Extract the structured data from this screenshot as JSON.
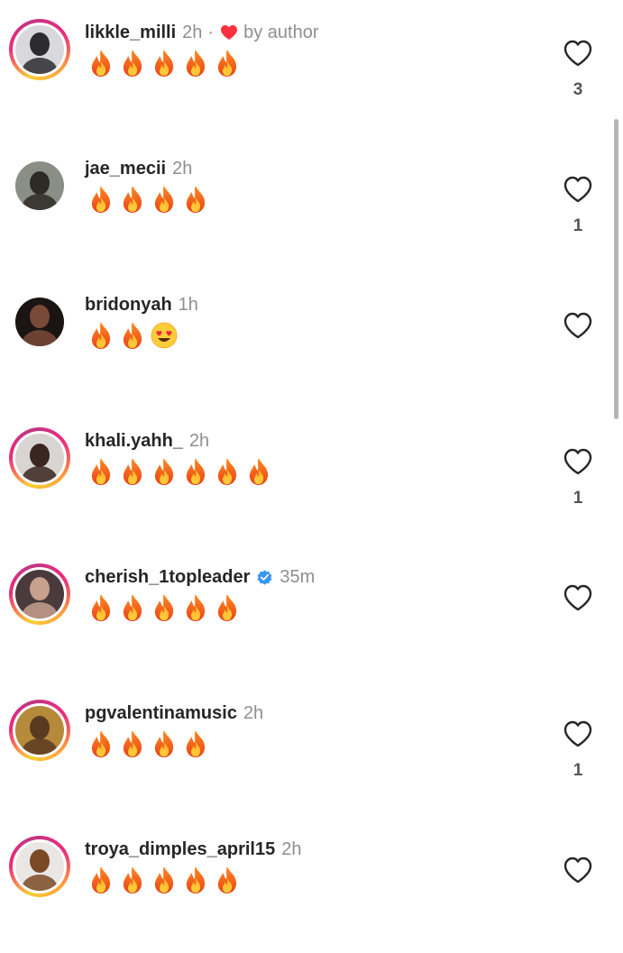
{
  "comments": [
    {
      "username": "likkle_milli",
      "time": "2h",
      "separator": "·",
      "liked_by_author": true,
      "by_author_label": "by author",
      "verified": false,
      "emojis": [
        "fire",
        "fire",
        "fire",
        "fire",
        "fire"
      ],
      "like_count": "3",
      "avatar_ring": true,
      "avatar_colors": [
        "#d9d9dc",
        "#2b2b30"
      ]
    },
    {
      "username": "jae_mecii",
      "time": "2h",
      "liked_by_author": false,
      "verified": false,
      "emojis": [
        "fire",
        "fire",
        "fire",
        "fire"
      ],
      "like_count": "1",
      "avatar_ring": false,
      "avatar_colors": [
        "#8a8f86",
        "#2e2a26"
      ]
    },
    {
      "username": "bridonyah",
      "time": "1h",
      "liked_by_author": false,
      "verified": false,
      "emojis": [
        "fire",
        "fire",
        "heart-eyes"
      ],
      "like_count": "",
      "avatar_ring": false,
      "avatar_colors": [
        "#1a1412",
        "#7a4a38"
      ]
    },
    {
      "username": "khali.yahh_",
      "time": "2h",
      "liked_by_author": false,
      "verified": false,
      "emojis": [
        "fire",
        "fire",
        "fire",
        "fire",
        "fire",
        "fire"
      ],
      "like_count": "1",
      "avatar_ring": true,
      "avatar_colors": [
        "#d8d4d2",
        "#3a2620"
      ]
    },
    {
      "username": "cherish_1topleader",
      "time": "35m",
      "liked_by_author": false,
      "verified": true,
      "emojis": [
        "fire",
        "fire",
        "fire",
        "fire",
        "fire"
      ],
      "like_count": "",
      "avatar_ring": true,
      "avatar_colors": [
        "#4a3a3c",
        "#c7a08e"
      ]
    },
    {
      "username": "pgvalentinamusic",
      "time": "2h",
      "liked_by_author": false,
      "verified": false,
      "emojis": [
        "fire",
        "fire",
        "fire",
        "fire"
      ],
      "like_count": "1",
      "avatar_ring": true,
      "avatar_colors": [
        "#b58a3a",
        "#5a3a22"
      ]
    },
    {
      "username": "troya_dimples_april15",
      "time": "2h",
      "liked_by_author": false,
      "verified": false,
      "emojis": [
        "fire",
        "fire",
        "fire",
        "fire",
        "fire"
      ],
      "like_count": "",
      "avatar_ring": true,
      "avatar_colors": [
        "#e9e6e4",
        "#7a4a26"
      ]
    }
  ],
  "colors": {
    "username": "#262626",
    "meta_gray": "#8e8e8e",
    "author_heart": "#ff3040",
    "verified_blue": "#3897f0",
    "like_count": "#555555",
    "scrollbar": "#b5b5b5"
  },
  "icons": {
    "like": "heart-outline-icon",
    "author_like": "heart-filled-icon",
    "verified": "verified-badge-icon",
    "fire": "fire-emoji-icon",
    "heart-eyes": "heart-eyes-emoji-icon"
  }
}
